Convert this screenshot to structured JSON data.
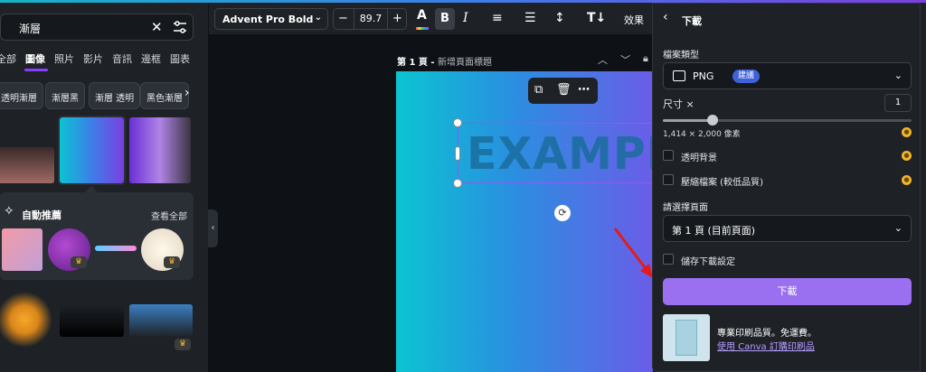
{
  "search": {
    "value": "漸層"
  },
  "left_tabs": [
    "全部",
    "圖像",
    "照片",
    "影片",
    "音訊",
    "邊框",
    "圖表"
  ],
  "chips": [
    "透明漸層",
    "漸層黑",
    "漸層 透明",
    "黑色漸層"
  ],
  "ai_section": {
    "title": "自動推薦",
    "see_all": "查看全部"
  },
  "toolbar": {
    "font": "Advent Pro Bold",
    "font_size": "89.7",
    "effects": "效果"
  },
  "page": {
    "label": "第 1 頁 - ",
    "title_placeholder": "新增頁面標題"
  },
  "canvas": {
    "text": "EXAMPLE"
  },
  "download": {
    "header": "下載",
    "file_type_label": "檔案類型",
    "file_type": "PNG",
    "recommended_badge": "建議",
    "size_label": "尺寸 ×",
    "size_value": "1",
    "size_fraction": 0.2,
    "dimensions": "1,414 × 2,000 像素",
    "transparent_bg": "透明背景",
    "compress": "壓縮檔案 (較低品質)",
    "select_pages_label": "請選擇頁面",
    "pages_value": "第 1 頁 (目前頁面)",
    "save_settings": "儲存下載設定",
    "download_button": "下載",
    "promo_line1": "專業印刷品質。免運費。",
    "promo_link": "使用 Canva 訂購印刷品"
  },
  "colors": {
    "accent": "#8b3dff",
    "download_button": "#9a6ff0",
    "badge": "#3f62d8",
    "pro_coin": "#f3b52a"
  }
}
